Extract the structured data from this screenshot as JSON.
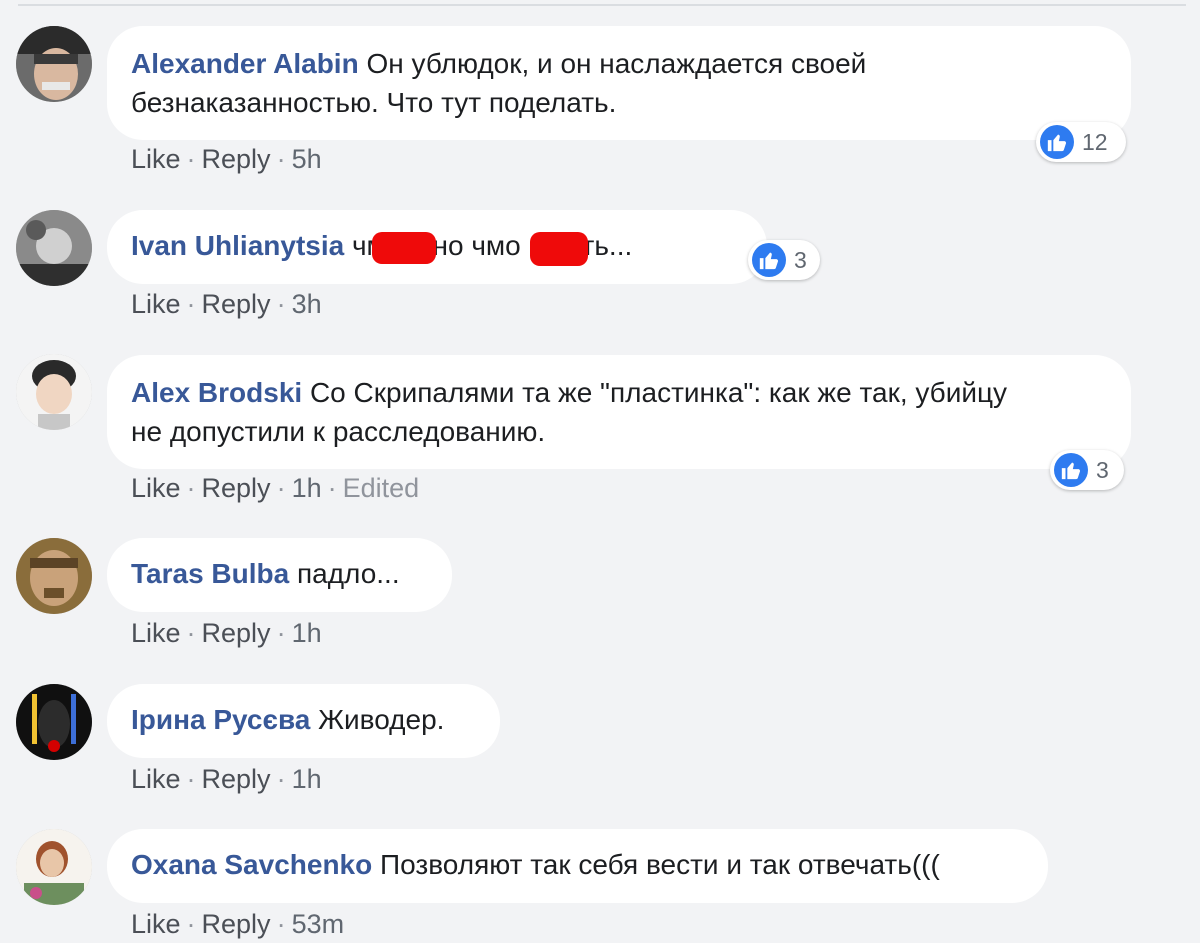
{
  "colors": {
    "background": "#f2f3f5",
    "author": "#385898",
    "like_blue": "#2e7bf0",
    "redaction": "#ef0a0a"
  },
  "actions": {
    "like": "Like",
    "reply": "Reply",
    "separator": "·"
  },
  "comments": [
    {
      "author": "Alexander Alabin",
      "line1": "Он ублюдок, и он наслаждается своей",
      "line2": "безнаказанностью. Что тут поделать.",
      "time": "5h",
      "likes": "12",
      "like_icon": "thumbs-up-icon"
    },
    {
      "author": "Ivan Uhlianytsia",
      "line1": "чмо, оно чмо и есть...",
      "time": "3h",
      "likes": "3",
      "like_icon": "thumbs-up-icon"
    },
    {
      "author": "Alex Brodski",
      "line1": "Со Скрипалями та же \"пластинка\": как же так, убийцу",
      "line2": "не допустили к расследованию.",
      "time": "1h",
      "edited": "Edited",
      "likes": "3",
      "like_icon": "thumbs-up-icon"
    },
    {
      "author": "Taras Bulba",
      "line1": "падло...",
      "time": "1h"
    },
    {
      "author": "Ірина Русєва",
      "line1": "Живодер.",
      "time": "1h"
    },
    {
      "author": "Oxana Savchenko",
      "line1": "Позволяют так себя вести и так отвечать(((",
      "time": "53m"
    }
  ]
}
